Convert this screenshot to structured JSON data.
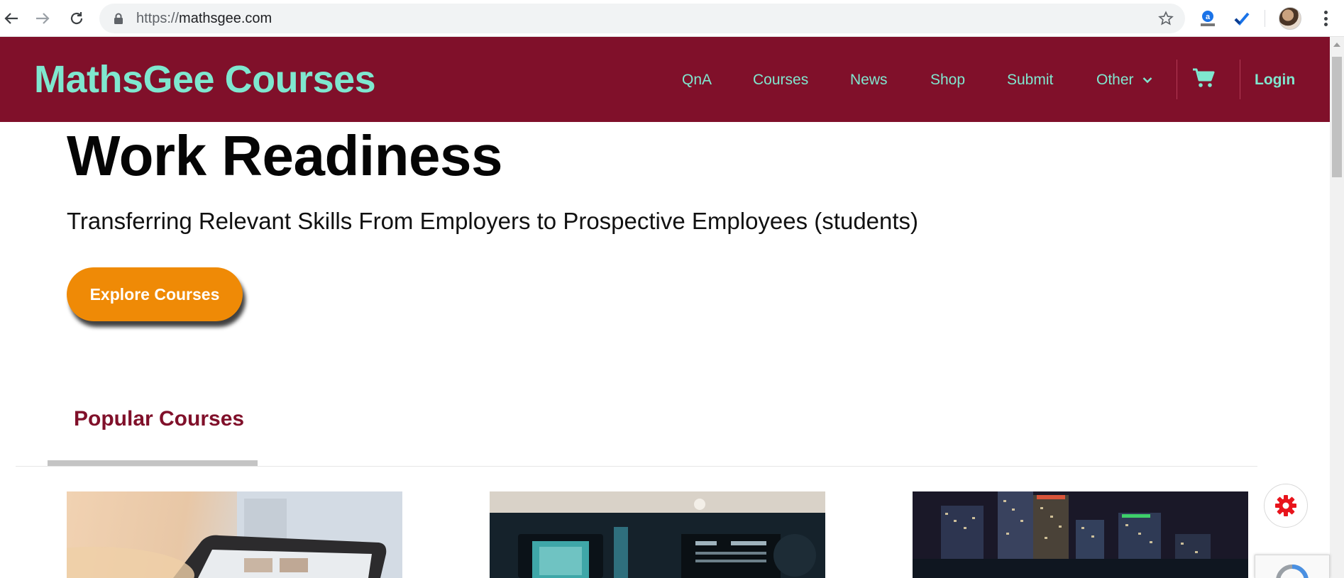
{
  "browser": {
    "url_scheme": "https://",
    "url_host": "mathsgee.com",
    "back_icon": "arrow-left-icon",
    "forward_icon": "arrow-right-icon",
    "reload_icon": "reload-icon",
    "bookmark_icon": "star-icon",
    "extensions": [
      "amazon-extension-icon",
      "checkmark-extension-icon"
    ],
    "profile_icon": "avatar",
    "menu_icon": "more-vertical-icon"
  },
  "header": {
    "brand": "MathsGee Courses",
    "background_color": "#80102a",
    "accent_color": "#7fe7cf",
    "menu": [
      {
        "label": "QnA"
      },
      {
        "label": "Courses"
      },
      {
        "label": "News"
      },
      {
        "label": "Shop"
      },
      {
        "label": "Submit"
      },
      {
        "label": "Other",
        "has_dropdown": true
      }
    ],
    "cart_icon": "cart-icon",
    "login_label": "Login"
  },
  "hero": {
    "title": "Work Readiness",
    "subtitle": "Transferring Relevant Skills From Employers to Prospective Employees (students)",
    "cta_label": "Explore Courses",
    "cta_color": "#ef8a06"
  },
  "tabs": {
    "active_label": "Popular Courses"
  },
  "courses": [
    {
      "image": "tablet-photo"
    },
    {
      "image": "camera-photo"
    },
    {
      "image": "city-night-photo"
    }
  ],
  "widgets": {
    "settings_icon": "gear-icon",
    "settings_color": "#e8141c",
    "recaptcha_icon": "recaptcha-icon"
  }
}
